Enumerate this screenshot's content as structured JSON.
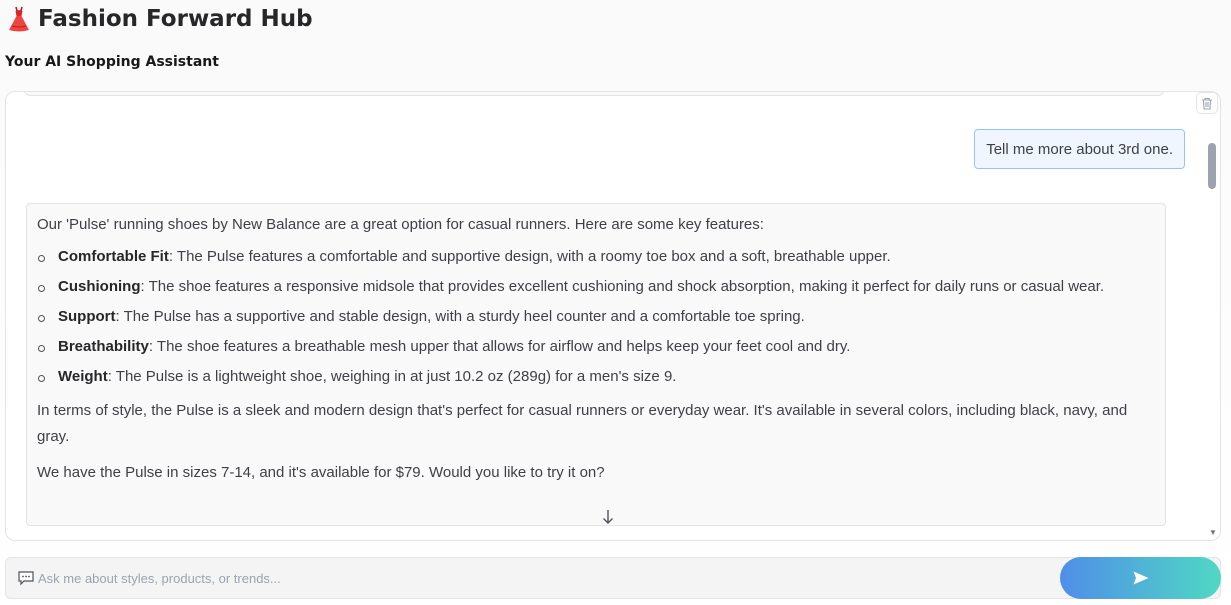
{
  "header": {
    "title": "Fashion Forward Hub",
    "title_icon": "dress-icon",
    "subtitle": "Your AI Shopping Assistant"
  },
  "chat": {
    "user_message": "Tell me more about 3rd one.",
    "assistant": {
      "intro": "Our 'Pulse' running shoes by New Balance are a great option for casual runners. Here are some key features:",
      "features": [
        {
          "label": "Comfortable Fit",
          "text": ": The Pulse features a comfortable and supportive design, with a roomy toe box and a soft, breathable upper."
        },
        {
          "label": "Cushioning",
          "text": ": The shoe features a responsive midsole that provides excellent cushioning and shock absorption, making it perfect for daily runs or casual wear."
        },
        {
          "label": "Support",
          "text": ": The Pulse has a supportive and stable design, with a sturdy heel counter and a comfortable toe spring."
        },
        {
          "label": "Breathability",
          "text": ": The shoe features a breathable mesh upper that allows for airflow and helps keep your feet cool and dry."
        },
        {
          "label": "Weight",
          "text": ": The Pulse is a lightweight shoe, weighing in at just 10.2 oz (289g) for a men's size 9."
        }
      ],
      "style_paragraph": "In terms of style, the Pulse is a sleek and modern design that's perfect for casual runners or everyday wear. It's available in several colors, including black, navy, and gray.",
      "closing": "We have the Pulse in sizes 7-14, and it's available for $79. Would you like to try it on?"
    },
    "clear_icon": "trash-icon",
    "scroll_icon": "arrow-down-icon"
  },
  "input": {
    "placeholder": "Ask me about styles, products, or trends...",
    "value": "",
    "chat_icon": "speech-bubble-icon",
    "send_icon": "send-arrow-icon"
  },
  "colors": {
    "user_bubble_bg": "#eff6ff",
    "user_bubble_border": "#93c5fd",
    "send_gradient_start": "#4f8ee8",
    "send_gradient_end": "#4fd8c4"
  }
}
